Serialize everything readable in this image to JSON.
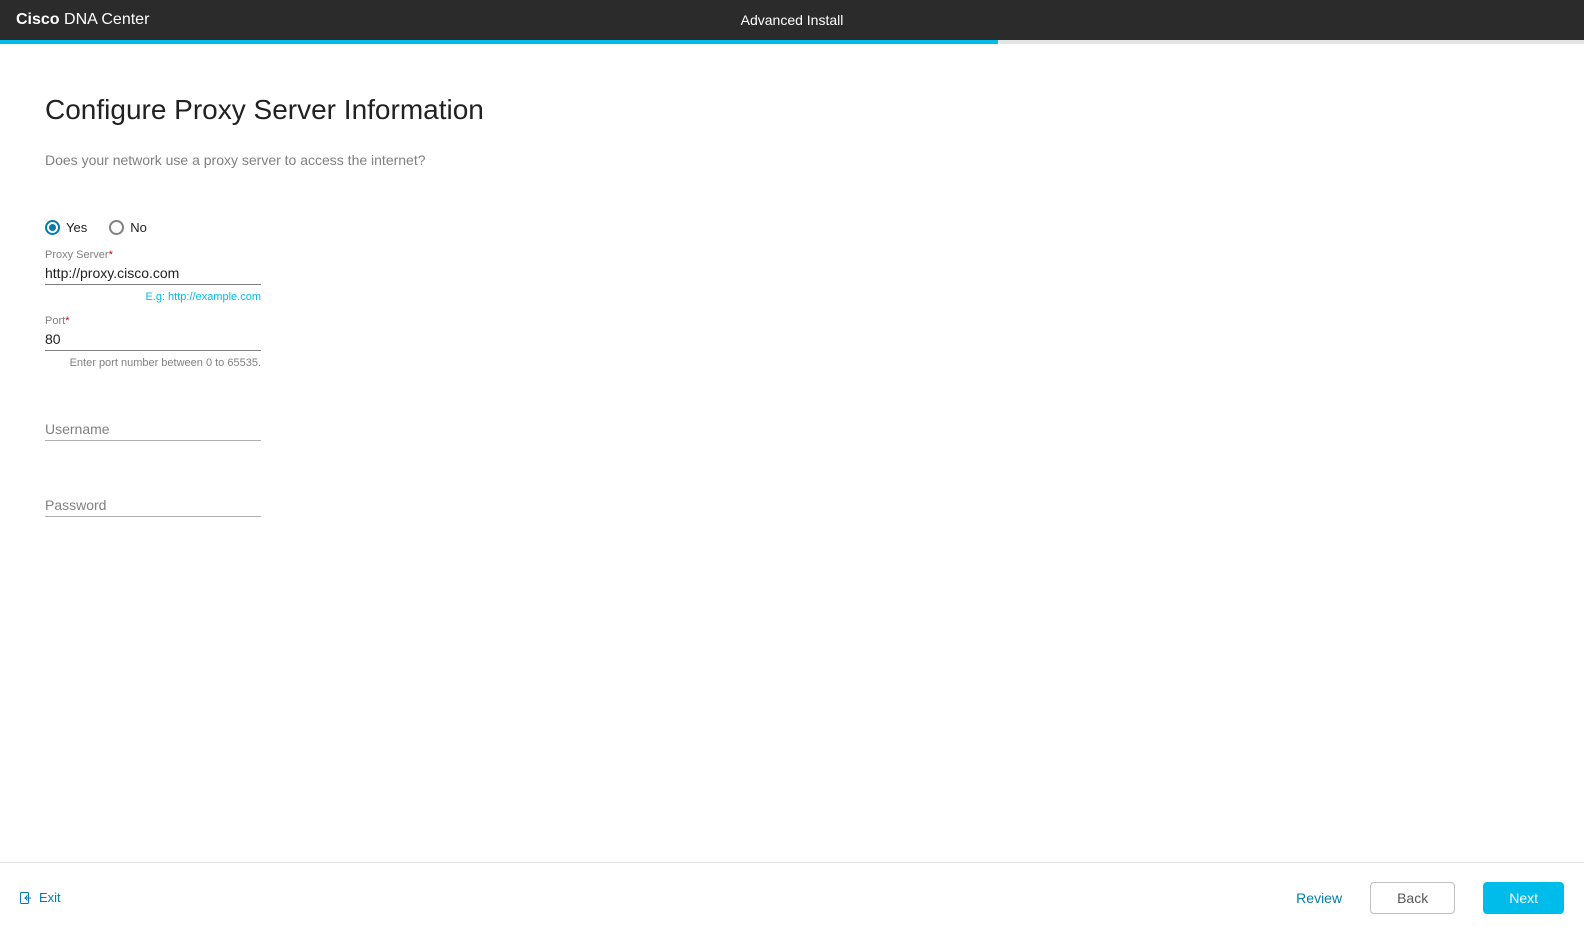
{
  "header": {
    "brand_bold": "Cisco",
    "brand_rest": " DNA Center",
    "title": "Advanced Install"
  },
  "progress": {
    "percent": 63
  },
  "page": {
    "title": "Configure Proxy Server Information",
    "subtitle": "Does your network use a proxy server to access the internet?"
  },
  "radio": {
    "yes_label": "Yes",
    "no_label": "No",
    "selected": "yes"
  },
  "fields": {
    "proxy_server": {
      "label": "Proxy Server",
      "value": "http://proxy.cisco.com",
      "hint": "E.g: http://example.com"
    },
    "port": {
      "label": "Port",
      "value": "80",
      "hint": "Enter port number between 0 to 65535."
    },
    "username": {
      "placeholder": "Username",
      "value": ""
    },
    "password": {
      "placeholder": "Password",
      "value": ""
    }
  },
  "footer": {
    "exit_label": "Exit",
    "review_label": "Review",
    "back_label": "Back",
    "next_label": "Next"
  }
}
